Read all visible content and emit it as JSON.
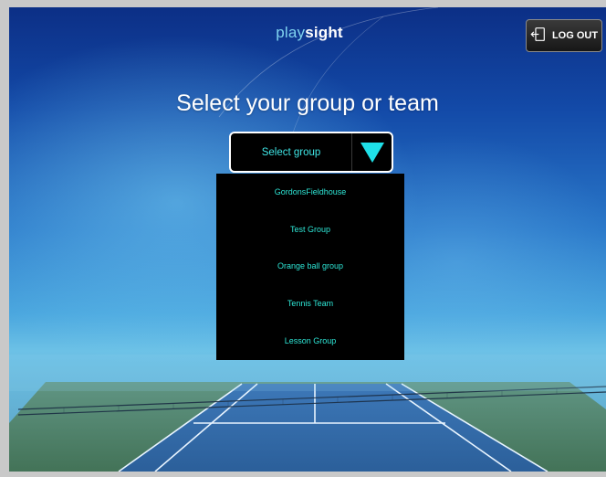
{
  "logo": {
    "part1": "play",
    "part2": "sight"
  },
  "header": {
    "logout_label": "LOG OUT",
    "logout_icon": "logout-door-icon"
  },
  "main": {
    "heading": "Select your group or team",
    "select": {
      "value": "Select group",
      "arrow_icon": "triangle-down-icon",
      "arrow_color": "#1fe0e8",
      "options": [
        "GordonsFieldhouse",
        "Test Group",
        "Orange ball group",
        "Tennis Team",
        "Lesson Group"
      ]
    }
  },
  "colors": {
    "accent": "#2ee6d6",
    "dropdown_bg": "#000000",
    "heading": "#ffffff"
  }
}
